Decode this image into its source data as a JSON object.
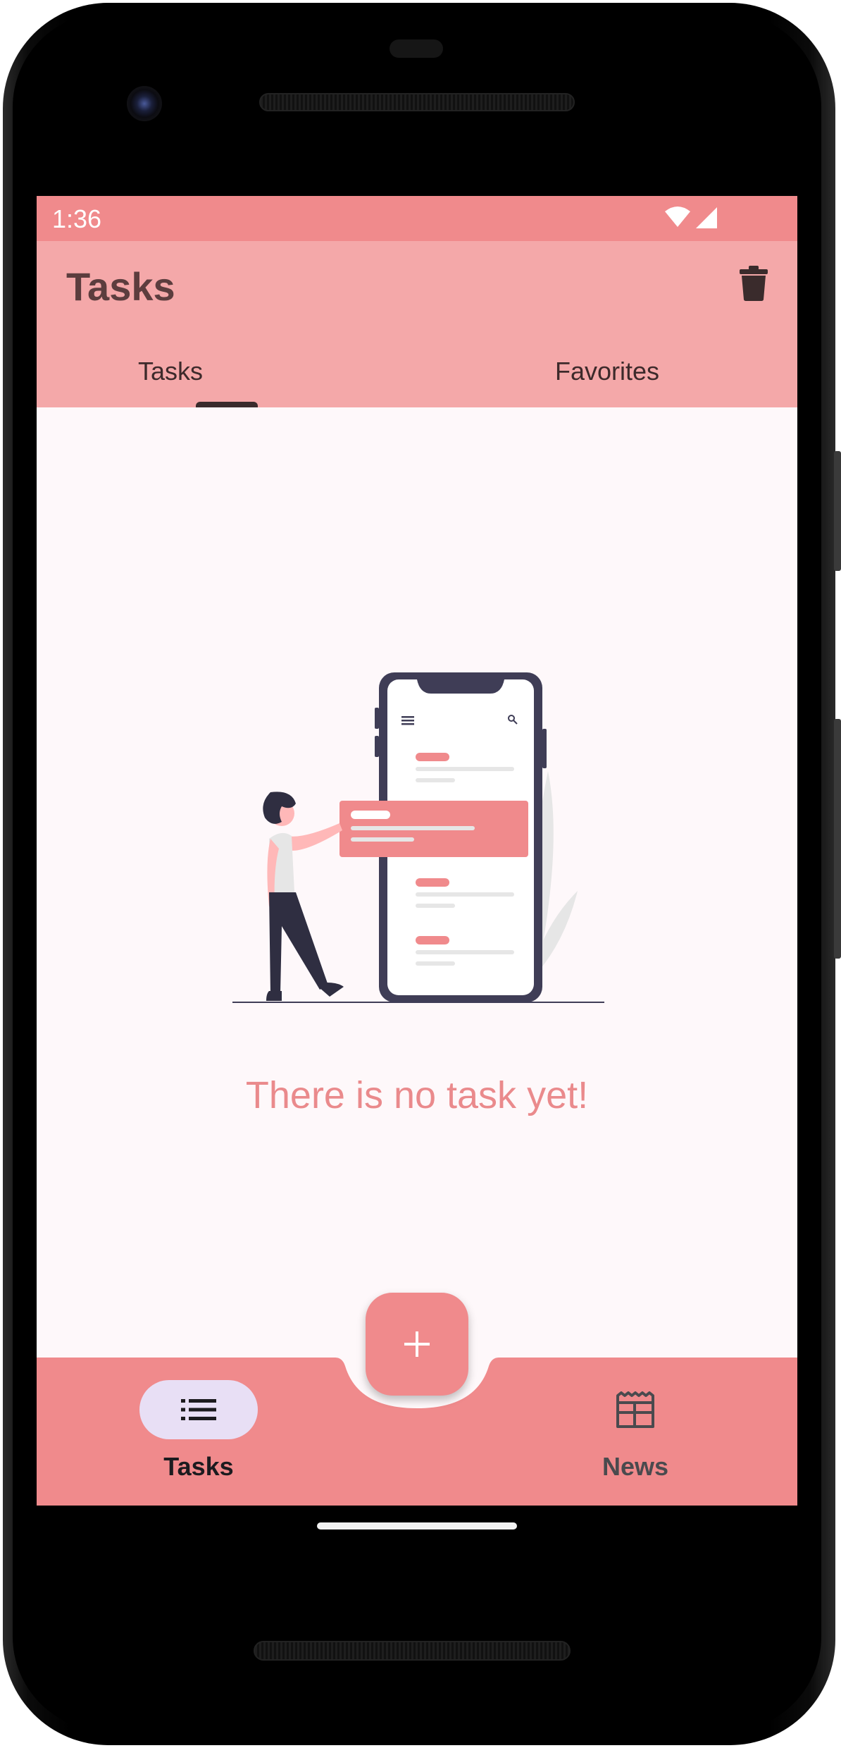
{
  "status_bar": {
    "time": "1:36",
    "icons": [
      "wifi-icon",
      "cellular-signal-icon"
    ]
  },
  "app_bar": {
    "title": "Tasks",
    "action_icon": "trash-icon"
  },
  "tabs": [
    {
      "label": "Tasks",
      "selected": true
    },
    {
      "label": "Favorites",
      "selected": false
    }
  ],
  "empty_state": {
    "message": "There is no task yet!",
    "illustration": "person-with-phone-task-list-illustration"
  },
  "fab": {
    "icon": "plus-icon"
  },
  "bottom_nav": {
    "items": [
      {
        "label": "Tasks",
        "icon": "list-icon",
        "selected": true
      },
      {
        "label": "News",
        "icon": "newspaper-icon",
        "selected": false
      }
    ]
  },
  "colors": {
    "status_bar": "#f08a8c",
    "app_bar": "#f4a8a9",
    "screen_bg": "#fef8fa",
    "accent": "#f08a8c",
    "empty_text": "#ea8a8c",
    "nav_pill": "#e8dff5",
    "title_text": "#5c3d3e"
  }
}
